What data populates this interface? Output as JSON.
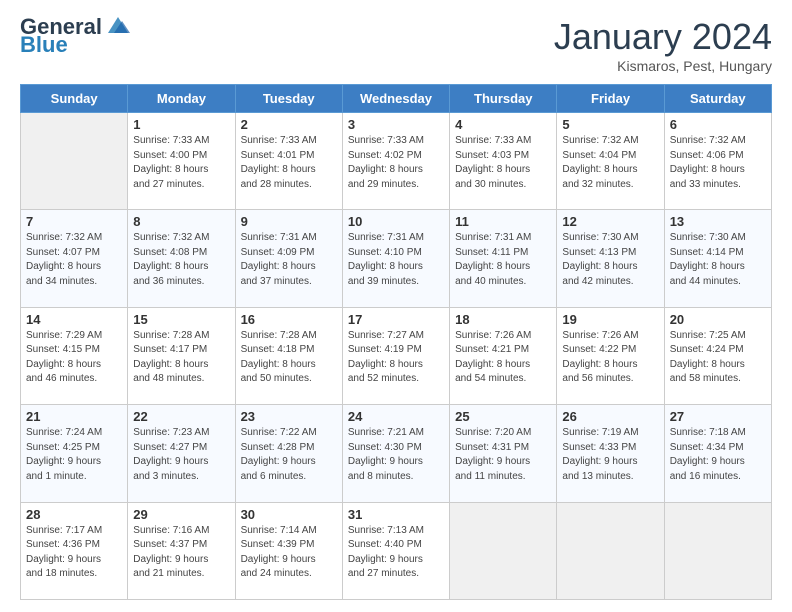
{
  "header": {
    "logo_general": "General",
    "logo_blue": "Blue",
    "month_title": "January 2024",
    "subtitle": "Kismaros, Pest, Hungary"
  },
  "days_of_week": [
    "Sunday",
    "Monday",
    "Tuesday",
    "Wednesday",
    "Thursday",
    "Friday",
    "Saturday"
  ],
  "weeks": [
    [
      {
        "num": "",
        "info": ""
      },
      {
        "num": "1",
        "info": "Sunrise: 7:33 AM\nSunset: 4:00 PM\nDaylight: 8 hours\nand 27 minutes."
      },
      {
        "num": "2",
        "info": "Sunrise: 7:33 AM\nSunset: 4:01 PM\nDaylight: 8 hours\nand 28 minutes."
      },
      {
        "num": "3",
        "info": "Sunrise: 7:33 AM\nSunset: 4:02 PM\nDaylight: 8 hours\nand 29 minutes."
      },
      {
        "num": "4",
        "info": "Sunrise: 7:33 AM\nSunset: 4:03 PM\nDaylight: 8 hours\nand 30 minutes."
      },
      {
        "num": "5",
        "info": "Sunrise: 7:32 AM\nSunset: 4:04 PM\nDaylight: 8 hours\nand 32 minutes."
      },
      {
        "num": "6",
        "info": "Sunrise: 7:32 AM\nSunset: 4:06 PM\nDaylight: 8 hours\nand 33 minutes."
      }
    ],
    [
      {
        "num": "7",
        "info": "Sunrise: 7:32 AM\nSunset: 4:07 PM\nDaylight: 8 hours\nand 34 minutes."
      },
      {
        "num": "8",
        "info": "Sunrise: 7:32 AM\nSunset: 4:08 PM\nDaylight: 8 hours\nand 36 minutes."
      },
      {
        "num": "9",
        "info": "Sunrise: 7:31 AM\nSunset: 4:09 PM\nDaylight: 8 hours\nand 37 minutes."
      },
      {
        "num": "10",
        "info": "Sunrise: 7:31 AM\nSunset: 4:10 PM\nDaylight: 8 hours\nand 39 minutes."
      },
      {
        "num": "11",
        "info": "Sunrise: 7:31 AM\nSunset: 4:11 PM\nDaylight: 8 hours\nand 40 minutes."
      },
      {
        "num": "12",
        "info": "Sunrise: 7:30 AM\nSunset: 4:13 PM\nDaylight: 8 hours\nand 42 minutes."
      },
      {
        "num": "13",
        "info": "Sunrise: 7:30 AM\nSunset: 4:14 PM\nDaylight: 8 hours\nand 44 minutes."
      }
    ],
    [
      {
        "num": "14",
        "info": "Sunrise: 7:29 AM\nSunset: 4:15 PM\nDaylight: 8 hours\nand 46 minutes."
      },
      {
        "num": "15",
        "info": "Sunrise: 7:28 AM\nSunset: 4:17 PM\nDaylight: 8 hours\nand 48 minutes."
      },
      {
        "num": "16",
        "info": "Sunrise: 7:28 AM\nSunset: 4:18 PM\nDaylight: 8 hours\nand 50 minutes."
      },
      {
        "num": "17",
        "info": "Sunrise: 7:27 AM\nSunset: 4:19 PM\nDaylight: 8 hours\nand 52 minutes."
      },
      {
        "num": "18",
        "info": "Sunrise: 7:26 AM\nSunset: 4:21 PM\nDaylight: 8 hours\nand 54 minutes."
      },
      {
        "num": "19",
        "info": "Sunrise: 7:26 AM\nSunset: 4:22 PM\nDaylight: 8 hours\nand 56 minutes."
      },
      {
        "num": "20",
        "info": "Sunrise: 7:25 AM\nSunset: 4:24 PM\nDaylight: 8 hours\nand 58 minutes."
      }
    ],
    [
      {
        "num": "21",
        "info": "Sunrise: 7:24 AM\nSunset: 4:25 PM\nDaylight: 9 hours\nand 1 minute."
      },
      {
        "num": "22",
        "info": "Sunrise: 7:23 AM\nSunset: 4:27 PM\nDaylight: 9 hours\nand 3 minutes."
      },
      {
        "num": "23",
        "info": "Sunrise: 7:22 AM\nSunset: 4:28 PM\nDaylight: 9 hours\nand 6 minutes."
      },
      {
        "num": "24",
        "info": "Sunrise: 7:21 AM\nSunset: 4:30 PM\nDaylight: 9 hours\nand 8 minutes."
      },
      {
        "num": "25",
        "info": "Sunrise: 7:20 AM\nSunset: 4:31 PM\nDaylight: 9 hours\nand 11 minutes."
      },
      {
        "num": "26",
        "info": "Sunrise: 7:19 AM\nSunset: 4:33 PM\nDaylight: 9 hours\nand 13 minutes."
      },
      {
        "num": "27",
        "info": "Sunrise: 7:18 AM\nSunset: 4:34 PM\nDaylight: 9 hours\nand 16 minutes."
      }
    ],
    [
      {
        "num": "28",
        "info": "Sunrise: 7:17 AM\nSunset: 4:36 PM\nDaylight: 9 hours\nand 18 minutes."
      },
      {
        "num": "29",
        "info": "Sunrise: 7:16 AM\nSunset: 4:37 PM\nDaylight: 9 hours\nand 21 minutes."
      },
      {
        "num": "30",
        "info": "Sunrise: 7:14 AM\nSunset: 4:39 PM\nDaylight: 9 hours\nand 24 minutes."
      },
      {
        "num": "31",
        "info": "Sunrise: 7:13 AM\nSunset: 4:40 PM\nDaylight: 9 hours\nand 27 minutes."
      },
      {
        "num": "",
        "info": ""
      },
      {
        "num": "",
        "info": ""
      },
      {
        "num": "",
        "info": ""
      }
    ]
  ]
}
